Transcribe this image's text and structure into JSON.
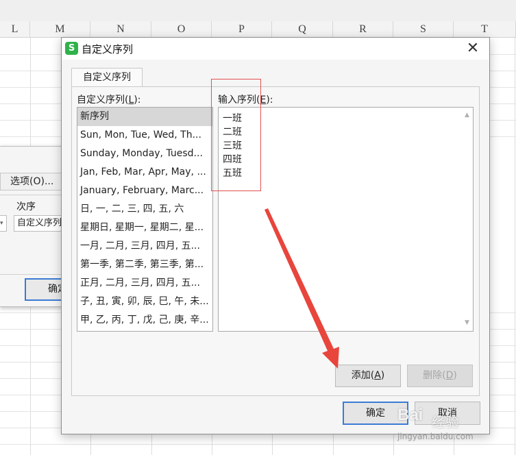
{
  "spreadsheet": {
    "columns": [
      "L",
      "M",
      "N",
      "O",
      "P",
      "Q",
      "R",
      "S",
      "T"
    ]
  },
  "sort_dialog": {
    "options_button": "选项(O)...",
    "order_label": "次序",
    "order_value": "自定义序列",
    "ok_button": "确定"
  },
  "dialog": {
    "title": "自定义序列",
    "tab_label": "自定义序列",
    "list_label_pre": "自定义序列(",
    "list_label_key": "L",
    "list_label_post": "):",
    "entries_label_pre": "输入序列(",
    "entries_label_key": "E",
    "entries_label_post": "):",
    "lists": [
      "新序列",
      "Sun, Mon, Tue, Wed, Th...",
      "Sunday, Monday, Tuesd...",
      "Jan, Feb, Mar, Apr, May, ...",
      "January, February, Marc...",
      "日, 一, 二, 三, 四, 五, 六",
      "星期日, 星期一, 星期二, 星...",
      "一月, 二月, 三月, 四月, 五...",
      "第一季, 第二季, 第三季, 第...",
      "正月, 二月, 三月, 四月, 五...",
      "子, 丑, 寅, 卯, 辰, 巳, 午, 未...",
      "甲, 乙, 丙, 丁, 戊, 己, 庚, 辛..."
    ],
    "entries": [
      "一班",
      "二班",
      "三班",
      "四班",
      "五班"
    ],
    "add_pre": "添加(",
    "add_key": "A",
    "add_post": ")",
    "delete_pre": "删除(",
    "delete_key": "D",
    "delete_post": ")",
    "ok_label": "确定",
    "cancel_label": "取消"
  },
  "watermark": {
    "logo": "Bai",
    "sub": "经验",
    "url": "jingyan.baidu.com"
  }
}
